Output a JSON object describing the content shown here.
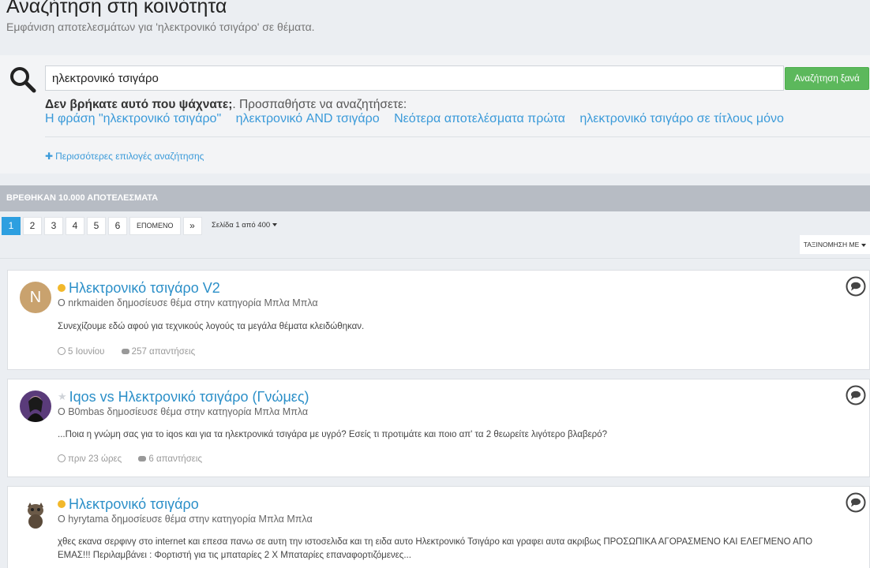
{
  "header": {
    "title": "Αναζήτηση στη κοινότητα",
    "subtitle": "Εμφάνιση αποτελεσμάτων για 'ηλεκτρονικό τσιγάρο' σε θέματα."
  },
  "search": {
    "value": "ηλεκτρονικό τσιγάρο",
    "button_label": "Αναζήτηση ξανά",
    "not_found_bold": "Δεν βρήκατε αυτό που ψάχνατε;",
    "not_found_rest": ". Προσπαθήστε να αναζητήσετε:",
    "suggestions": [
      "Η φράση \"ηλεκτρονικό τσιγάρο\"",
      "ηλεκτρονικό AND τσιγάρο",
      "Νεότερα αποτελέσματα πρώτα",
      "ηλεκτρονικό τσιγάρο σε τίτλους μόνο"
    ],
    "more_options": "Περισσότερες επιλογές αναζήτησης"
  },
  "results": {
    "count_label": "ΒΡΕΘΗΚΑΝ 10.000 ΑΠΟΤΕΛΕΣΜΑΤΑ",
    "pages": [
      "1",
      "2",
      "3",
      "4",
      "5",
      "6"
    ],
    "next_label": "ΕΠΟΜΕΝΟ",
    "last_label": "»",
    "page_info": "Σελίδα 1 από 400",
    "sort_label": "ΤΑΞΙΝΟΜΗΣΗ ΜΕ"
  },
  "posts": [
    {
      "avatar_letter": "N",
      "title": "Ηλεκτρονικό τσιγάρο V2",
      "author_line": "Ο nrkmaiden δημοσίευσε θέμα στην κατηγορία Μπλα Μπλα",
      "excerpt": "Συνεχίζουμε εδώ αφού για τεχνικούς λογούς τα μεγάλα θέματα κλειδώθηκαν.",
      "date": "5 Ιουνίου",
      "replies": "257 απαντήσεις"
    },
    {
      "title": "Iqos vs Ηλεκτρονικό τσιγάρο (Γνώμες)",
      "author_line": "Ο B0mbas δημοσίευσε θέμα στην κατηγορία Μπλα Μπλα",
      "excerpt": "...Ποια η γνώμη σας για το iqos και για τα ηλεκτρονικά τσιγάρα με υγρό? Εσείς τι προτιμάτε και ποιο απ' τα 2 θεωρείτε λιγότερο βλαβερό?",
      "date": "πριν 23 ώρες",
      "replies": "6 απαντήσεις"
    },
    {
      "title": "Ηλεκτρονικό τσιγάρο",
      "author_line": "Ο hyrytama δημοσίευσε θέμα στην κατηγορία Μπλα Μπλα",
      "excerpt": "χθες εκανα σερφινγ στο internet και επεσα πανω σε αυτη την ιστοσελιδα και τη ειδα αυτο Ηλεκτρονικό Τσιγάρο και γραφει αυτα ακριβως ΠΡΟΣΩΠΙΚΑ ΑΓΟΡΑΣΜΕΝΟ ΚΑΙ ΕΛΕΓΜΕΝΟ ΑΠΟ ΕΜΑΣ!!! Περιλαμβάνει : Φορτιστή για τις μπαταρίες 2 Χ Μπαταρίες επαναφορτιζόμενες..."
    }
  ],
  "colors": {
    "accent": "#2d9fe0",
    "link": "#3a9ad9",
    "button_green": "#5cb85c",
    "results_bar": "#b7bcc4",
    "status_dot": "#f2b82b"
  }
}
